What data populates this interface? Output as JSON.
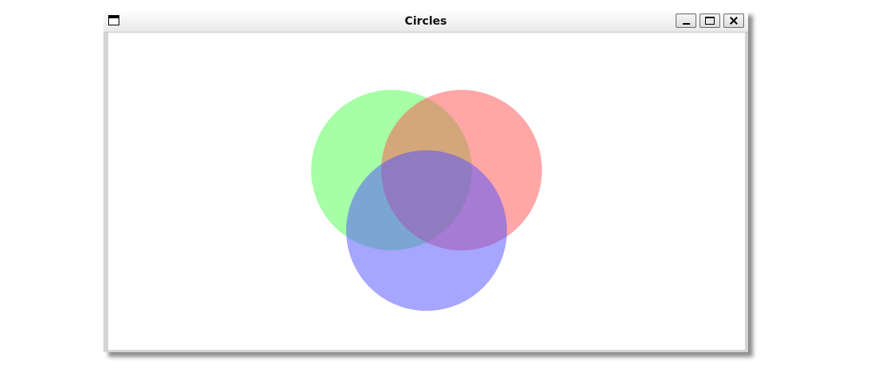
{
  "window": {
    "title": "Circles"
  },
  "icons": {
    "system_menu": "window-menu-icon",
    "minimize": "minimize-icon",
    "maximize": "maximize-icon",
    "close": "close-icon"
  },
  "circles": [
    {
      "name": "green-circle",
      "color": "#55ff55"
    },
    {
      "name": "red-circle",
      "color": "#ff5555"
    },
    {
      "name": "blue-circle",
      "color": "#5555ff"
    }
  ],
  "colors": {
    "canvas_background": "#ffffff",
    "window_frame": "#d4d4d4"
  }
}
